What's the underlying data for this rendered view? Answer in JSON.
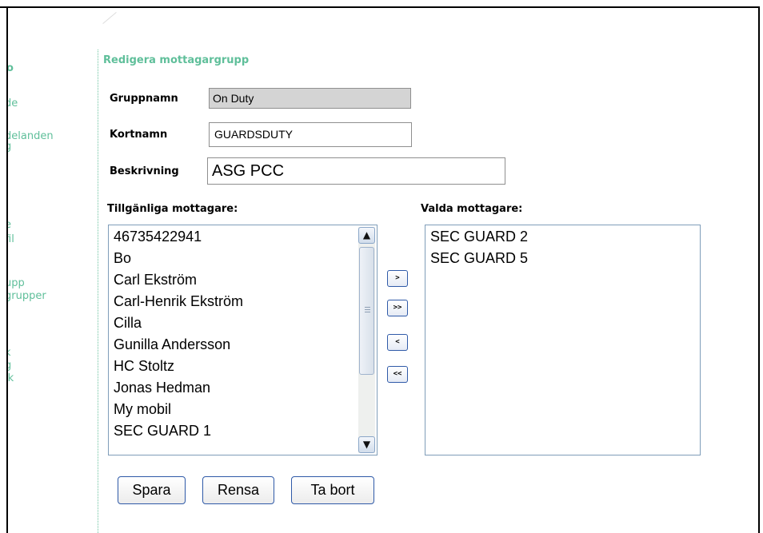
{
  "nav": {
    "items": [
      "o",
      "de",
      "delanden",
      "g",
      "e",
      " fil",
      "upp",
      "grupper",
      "k",
      "g",
      "ik"
    ]
  },
  "form": {
    "section_title": "Redigera mottagargrupp",
    "group_name": {
      "label": "Gruppnamn",
      "value": "On Duty"
    },
    "short_name": {
      "label": "Kortnamn",
      "value": "GUARDSDUTY"
    },
    "description": {
      "label": "Beskrivning",
      "value": "ASG PCC"
    }
  },
  "available": {
    "label": "Tillgänliga mottagare:",
    "options": [
      "46735422941",
      "Bo",
      "Carl Ekström",
      "Carl-Henrik Ekström",
      "Cilla",
      "Gunilla Andersson",
      "HC Stoltz",
      "Jonas Hedman",
      "My mobil",
      "SEC GUARD 1"
    ]
  },
  "selected": {
    "label": "Valda mottagare:",
    "options": [
      "SEC GUARD 2",
      "SEC GUARD 5"
    ]
  },
  "move_buttons": {
    "add": ">",
    "add_all": ">>",
    "remove": "<",
    "remove_all": "<<"
  },
  "actions": {
    "save": "Spara",
    "clear": "Rensa",
    "delete": "Ta bort"
  },
  "scrollbar": {
    "up": "▲",
    "down": "▼",
    "grip": "≡"
  }
}
